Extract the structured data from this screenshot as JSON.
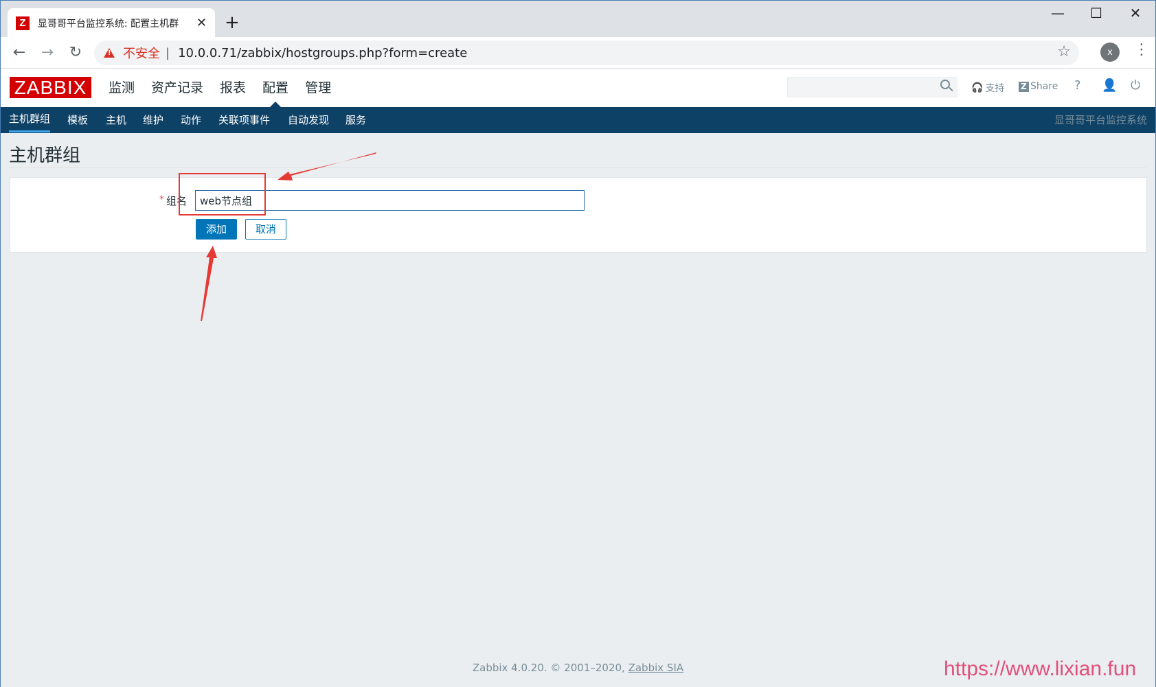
{
  "browser": {
    "tab_title": "显哥哥平台监控系统: 配置主机群",
    "favicon_letter": "Z",
    "new_tab": "+",
    "close_tab": "✕",
    "insecure_label": "不安全",
    "url_separator": "|",
    "url": "10.0.0.71/zabbix/hostgroups.php?form=create",
    "profile_letter": "x",
    "controls": {
      "minimize": "—",
      "maximize": "☐",
      "close": "✕"
    }
  },
  "header": {
    "logo": "ZABBIX",
    "menu": [
      {
        "label": "监测"
      },
      {
        "label": "资产记录"
      },
      {
        "label": "报表"
      },
      {
        "label": "配置"
      },
      {
        "label": "管理"
      }
    ],
    "search_placeholder": "",
    "support_label": "支持",
    "share_badge": "Z",
    "share_label": "Share",
    "help_label": "?"
  },
  "submenu": {
    "items": [
      {
        "label": "主机群组"
      },
      {
        "label": "模板"
      },
      {
        "label": "主机"
      },
      {
        "label": "维护"
      },
      {
        "label": "动作"
      },
      {
        "label": "关联项事件"
      },
      {
        "label": "自动发现"
      },
      {
        "label": "服务"
      }
    ],
    "brand": "显哥哥平台监控系统"
  },
  "page": {
    "title": "主机群组",
    "form": {
      "required_mark": "*",
      "group_name_label": "组名",
      "group_name_value": "web节点组",
      "add_button": "添加",
      "cancel_button": "取消"
    }
  },
  "footer": {
    "text": "Zabbix 4.0.20. © 2001–2020, ",
    "link": "Zabbix SIA"
  },
  "watermark": "https://www.lixian.fun",
  "colors": {
    "brand_red": "#d40000",
    "submenu_bg": "#0e4166",
    "button_blue": "#0275b8",
    "annotation_red": "#e53935"
  }
}
